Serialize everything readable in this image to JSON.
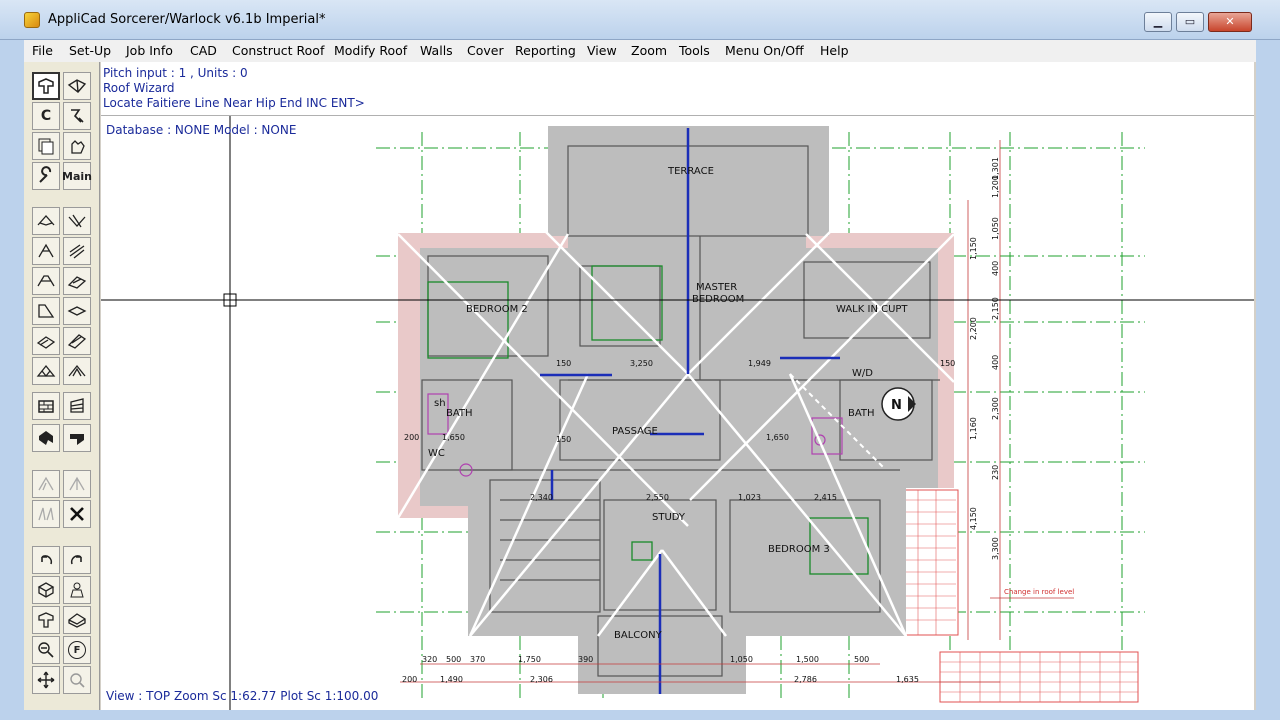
{
  "window": {
    "title": "AppliCad Sorcerer/Warlock v6.1b Imperial*",
    "controls": {
      "minimize": "▁",
      "maximize": "▭",
      "close": "✕"
    }
  },
  "menu": {
    "items": [
      {
        "label": "File"
      },
      {
        "label": "Set-Up"
      },
      {
        "label": "Job Info"
      },
      {
        "label": "CAD"
      },
      {
        "label": "Construct Roof"
      },
      {
        "label": "Modify Roof"
      },
      {
        "label": "Walls"
      },
      {
        "label": "Cover"
      },
      {
        "label": "Reporting"
      },
      {
        "label": "View"
      },
      {
        "label": "Zoom"
      },
      {
        "label": "Tools"
      },
      {
        "label": "Menu On/Off"
      },
      {
        "label": "Help"
      }
    ]
  },
  "command": {
    "line1": "Pitch input : 1 , Units : 0",
    "line2": "Roof Wizard",
    "line3": "Locate Faitiere Line Near Hip End INC ENT>"
  },
  "toolbar": {
    "clear_label": "C",
    "main_label": "Main",
    "f_label": "F"
  },
  "status": {
    "database": "Database : NONE   Model : NONE",
    "view": "View : TOP  Zoom Sc 1:62.77  Plot Sc 1:100.00"
  },
  "plan": {
    "rooms": {
      "terrace": "TERRACE",
      "master": "MASTER",
      "bedroom": "BEDROOM",
      "bedroom2": "BEDROOM 2",
      "bedroom3": "BEDROOM 3",
      "walk_in": "WALK IN CUPT",
      "bath1": "BATH",
      "bath2": "BATH",
      "passage": "PASSAGE",
      "study": "STUDY",
      "balcony": "BALCONY",
      "wc": "WC",
      "wd": "W/D",
      "sh": "sh"
    },
    "dims": {
      "d3250": "3,250",
      "d1949": "1,949",
      "d150a": "150",
      "d150b": "150",
      "d150c": "150",
      "d2550": "2,550",
      "d2415": "2,415",
      "d1650": "1,650",
      "d1650b": "1,650",
      "d2340": "2,340",
      "d1023": "1,023",
      "d320": "320",
      "d500": "500",
      "d370": "370",
      "d1750": "1,750",
      "d390": "390",
      "d200": "200",
      "d1490": "1,490",
      "d2306": "2,306",
      "d2786": "2,786",
      "d1050": "1,050",
      "d400": "400",
      "d400b": "400",
      "d200b": "200",
      "d2150": "2,150",
      "d1301": "1,301",
      "d1200": "1,200",
      "d1150": "1,150",
      "d2200": "2,200",
      "d2300": "2,300",
      "d230": "230",
      "d1160": "1,160",
      "d4150": "4,150",
      "d3300": "3,300",
      "d500b": "500",
      "d1635": "1,635",
      "d1050b": "1,050",
      "d1500": "1,500"
    },
    "labels": {
      "north": "N",
      "change": "Change in roof level"
    }
  }
}
